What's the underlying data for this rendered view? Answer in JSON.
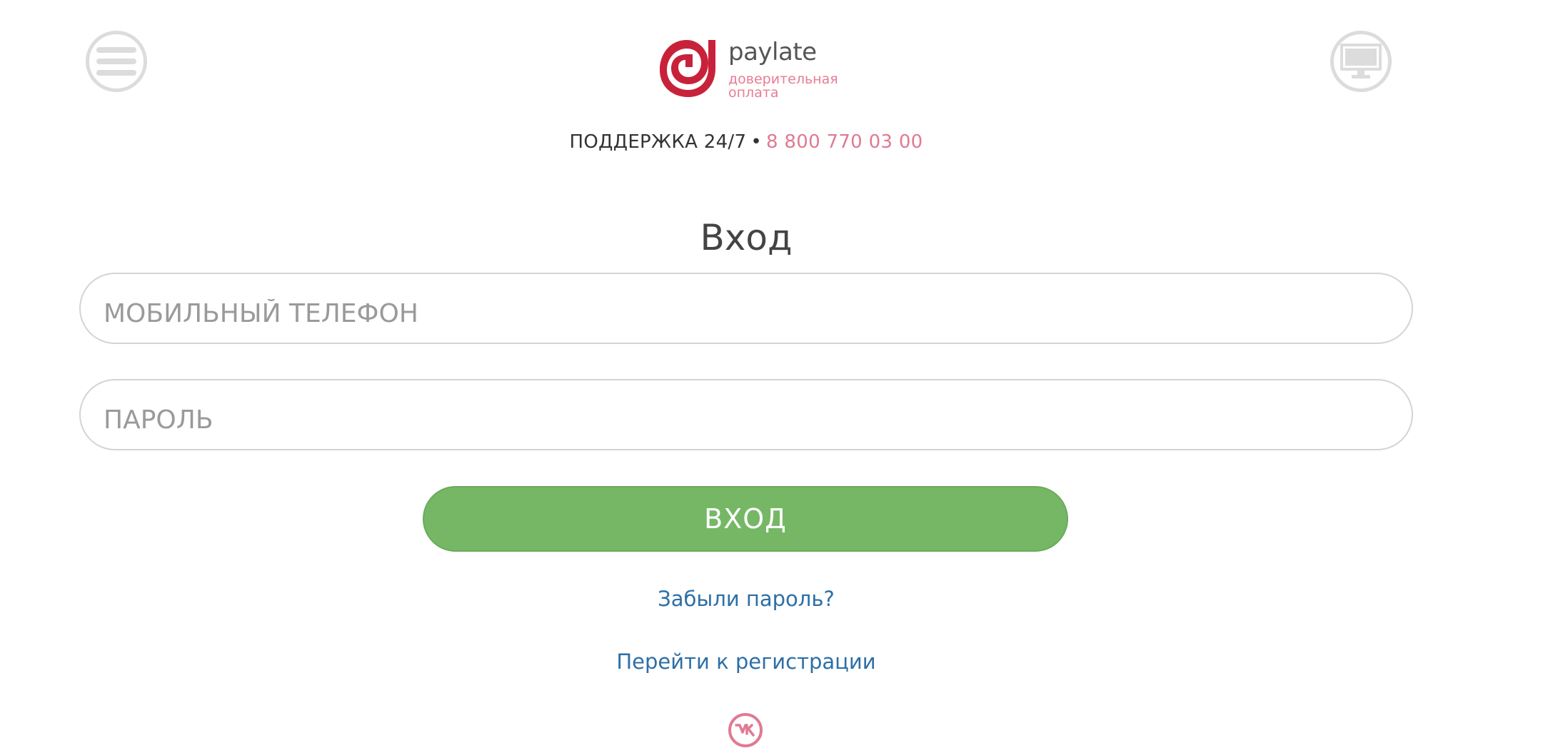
{
  "header": {
    "menu_icon": "hamburger-menu-icon",
    "desktop_icon": "desktop-monitor-icon",
    "logo": {
      "name": "paylate",
      "tagline_line1": "доверительная",
      "tagline_line2": "оплата"
    }
  },
  "support": {
    "label": "ПОДДЕРЖКА 24/7",
    "separator": "•",
    "phone": "8 800 770 03 00"
  },
  "login_form": {
    "title": "Вход",
    "phone_placeholder": "МОБИЛЬНЫЙ ТЕЛЕФОН",
    "password_placeholder": "ПАРОЛЬ",
    "submit_label": "ВХОД",
    "forgot_password_link": "Забыли пароль?",
    "register_link": "Перейти к регистрации"
  },
  "social": {
    "vk_icon": "vk-icon"
  },
  "colors": {
    "accent_pink": "#e07a92",
    "logo_red": "#c8223a",
    "button_green": "#76b766",
    "link_blue": "#2d6fa6",
    "icon_gray": "#dcdcdc"
  }
}
